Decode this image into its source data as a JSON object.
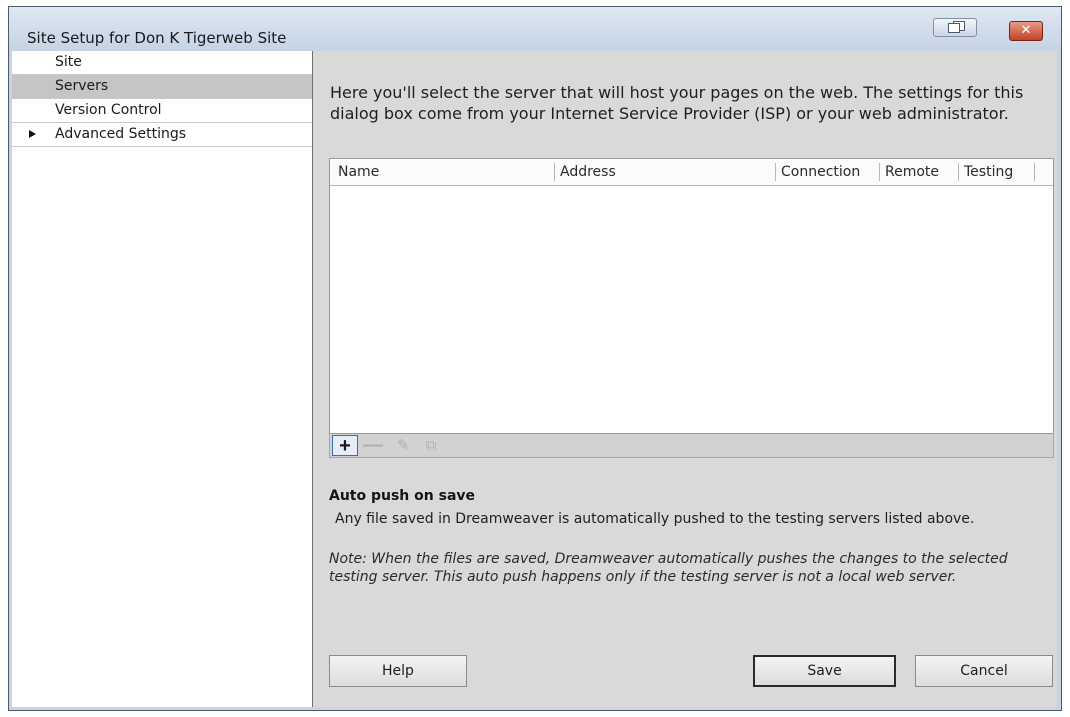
{
  "window": {
    "title": "Site Setup for Don K Tigerweb Site",
    "close_glyph": "✕"
  },
  "sidebar": {
    "items": [
      {
        "label": "Site"
      },
      {
        "label": "Servers",
        "selected": true
      },
      {
        "label": "Version Control"
      },
      {
        "label": "Advanced Settings",
        "expandable": true
      }
    ]
  },
  "main": {
    "intro": "Here you'll select the server that will host your pages on the web. The settings for this dialog box come from your Internet Service Provider (ISP) or your web administrator.",
    "table": {
      "columns": [
        "Name",
        "Address",
        "Connection",
        "Remote",
        "Testing"
      ],
      "rows": []
    },
    "toolbar": {
      "add_glyph": "+",
      "remove_glyph": "—",
      "edit_glyph": "✎",
      "duplicate_glyph": "⧉"
    },
    "auto_push": {
      "title": "Auto push on save",
      "description": "Any file saved in Dreamweaver is automatically pushed to the testing servers listed above.",
      "note": "Note: When the files are saved, Dreamweaver automatically pushes the changes to the selected testing server. This auto push happens only if the testing server is not a local web server."
    },
    "buttons": {
      "help": "Help",
      "save": "Save",
      "cancel": "Cancel"
    }
  },
  "icons": {
    "restore": "restore-window-icon",
    "close": "close-icon",
    "expand": "expand-arrow-icon",
    "add": "plus-icon",
    "remove": "minus-icon",
    "edit": "pencil-icon",
    "duplicate": "duplicate-icon"
  },
  "colors": {
    "selected_row": "#c5c5c5",
    "close_button": "#c2432a",
    "panel_background": "#d9d9d9"
  }
}
